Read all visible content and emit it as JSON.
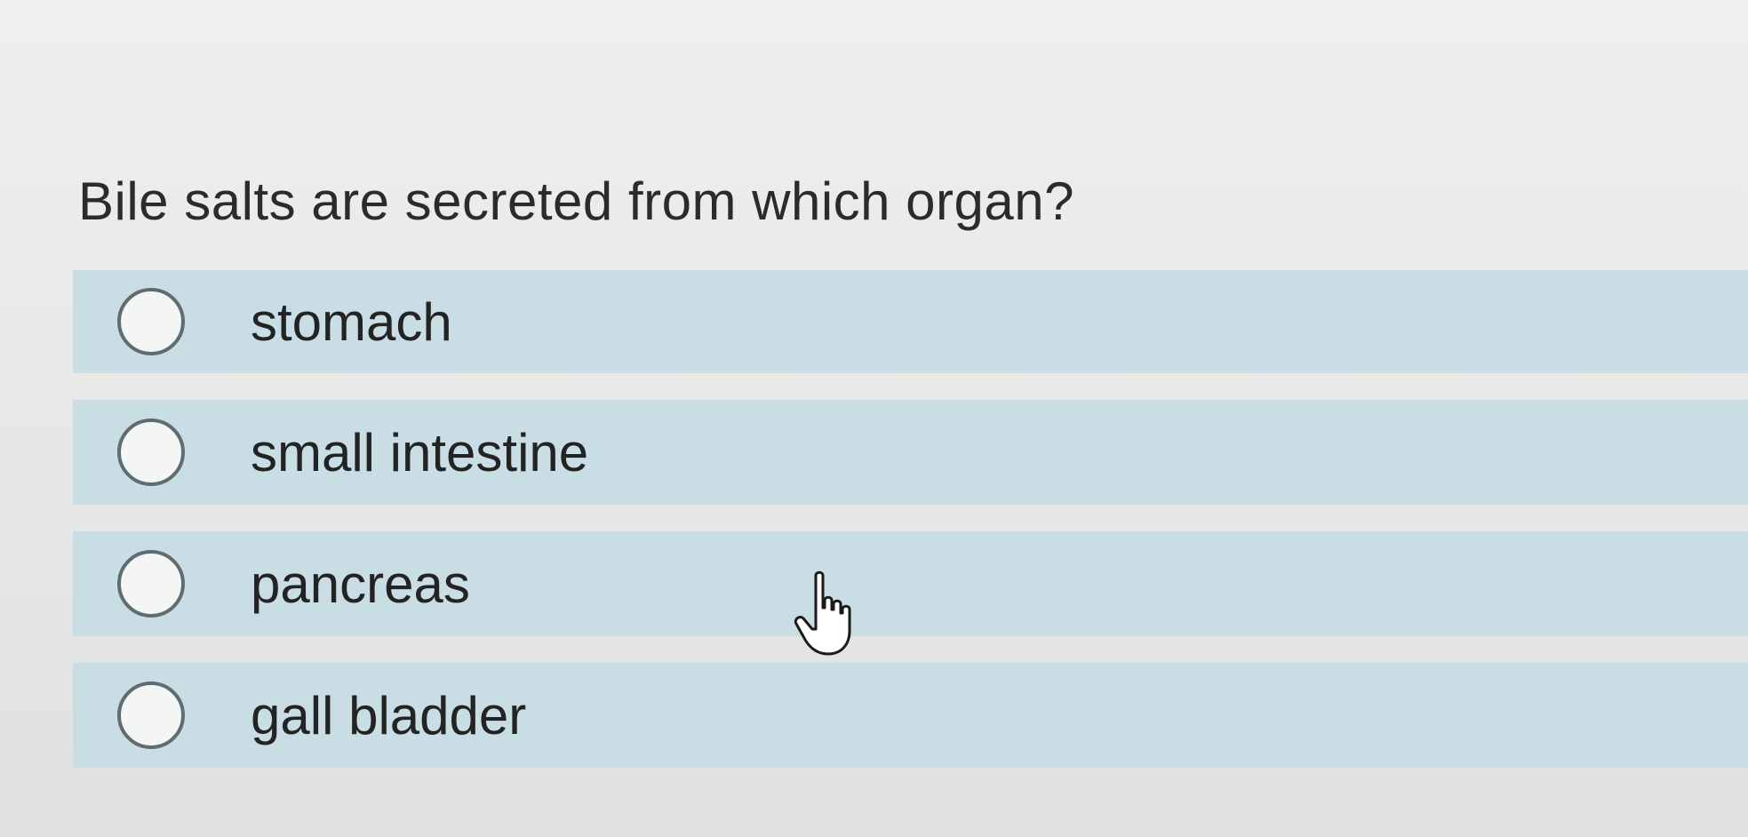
{
  "question": {
    "text": "Bile salts are secreted from which organ?"
  },
  "options": [
    {
      "label": "stomach",
      "selected": false
    },
    {
      "label": "small intestine",
      "selected": false
    },
    {
      "label": "pancreas",
      "selected": false
    },
    {
      "label": "gall bladder",
      "selected": false
    }
  ],
  "colors": {
    "option_background": "#c9dee4",
    "page_background": "#e9ebea",
    "text": "#232323",
    "radio_border": "#5f6d71"
  },
  "icons": {
    "cursor": "hand-pointer-icon"
  }
}
